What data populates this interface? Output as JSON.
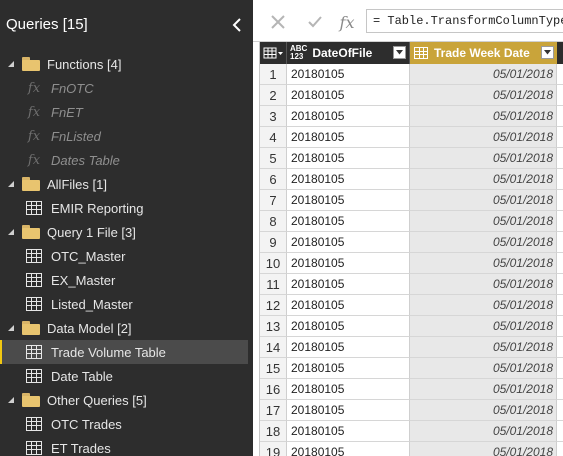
{
  "queries_pane": {
    "title": "Queries [15]",
    "groups": [
      {
        "name": "Functions [4]",
        "items": [
          {
            "label": "FnOTC",
            "type": "function"
          },
          {
            "label": "FnET",
            "type": "function"
          },
          {
            "label": "FnListed",
            "type": "function"
          },
          {
            "label": "Dates Table",
            "type": "function"
          }
        ]
      },
      {
        "name": "AllFiles [1]",
        "items": [
          {
            "label": "EMIR Reporting",
            "type": "table"
          }
        ]
      },
      {
        "name": "Query 1 File [3]",
        "items": [
          {
            "label": "OTC_Master",
            "type": "table"
          },
          {
            "label": "EX_Master",
            "type": "table"
          },
          {
            "label": "Listed_Master",
            "type": "table"
          }
        ]
      },
      {
        "name": "Data Model [2]",
        "items": [
          {
            "label": "Trade Volume Table",
            "type": "table",
            "selected": true
          },
          {
            "label": "Date Table",
            "type": "table"
          }
        ]
      },
      {
        "name": "Other Queries [5]",
        "items": [
          {
            "label": "OTC Trades",
            "type": "table"
          },
          {
            "label": "ET Trades",
            "type": "table"
          }
        ]
      }
    ]
  },
  "formula_bar": {
    "cancel_icon": "close-icon",
    "commit_icon": "check-icon",
    "fx_label": "fx",
    "formula": "= Table.TransformColumnTypes"
  },
  "grid": {
    "columns": [
      {
        "type_label": "ABC\n123",
        "name": "DateOfFile"
      },
      {
        "type_label": "table",
        "name": "Trade Week Date"
      }
    ],
    "rows": [
      {
        "n": "1",
        "date_of_file": "20180105",
        "trade_week_date": "05/01/2018"
      },
      {
        "n": "2",
        "date_of_file": "20180105",
        "trade_week_date": "05/01/2018"
      },
      {
        "n": "3",
        "date_of_file": "20180105",
        "trade_week_date": "05/01/2018"
      },
      {
        "n": "4",
        "date_of_file": "20180105",
        "trade_week_date": "05/01/2018"
      },
      {
        "n": "5",
        "date_of_file": "20180105",
        "trade_week_date": "05/01/2018"
      },
      {
        "n": "6",
        "date_of_file": "20180105",
        "trade_week_date": "05/01/2018"
      },
      {
        "n": "7",
        "date_of_file": "20180105",
        "trade_week_date": "05/01/2018"
      },
      {
        "n": "8",
        "date_of_file": "20180105",
        "trade_week_date": "05/01/2018"
      },
      {
        "n": "9",
        "date_of_file": "20180105",
        "trade_week_date": "05/01/2018"
      },
      {
        "n": "10",
        "date_of_file": "20180105",
        "trade_week_date": "05/01/2018"
      },
      {
        "n": "11",
        "date_of_file": "20180105",
        "trade_week_date": "05/01/2018"
      },
      {
        "n": "12",
        "date_of_file": "20180105",
        "trade_week_date": "05/01/2018"
      },
      {
        "n": "13",
        "date_of_file": "20180105",
        "trade_week_date": "05/01/2018"
      },
      {
        "n": "14",
        "date_of_file": "20180105",
        "trade_week_date": "05/01/2018"
      },
      {
        "n": "15",
        "date_of_file": "20180105",
        "trade_week_date": "05/01/2018"
      },
      {
        "n": "16",
        "date_of_file": "20180105",
        "trade_week_date": "05/01/2018"
      },
      {
        "n": "17",
        "date_of_file": "20180105",
        "trade_week_date": "05/01/2018"
      },
      {
        "n": "18",
        "date_of_file": "20180105",
        "trade_week_date": "05/01/2018"
      },
      {
        "n": "19",
        "date_of_file": "20180105",
        "trade_week_date": "05/01/2018"
      }
    ]
  },
  "colors": {
    "pane_bg": "#2d2d2d",
    "accent": "#f2c811",
    "selected_col": "#c9a43a",
    "folder": "#e8c46f"
  }
}
